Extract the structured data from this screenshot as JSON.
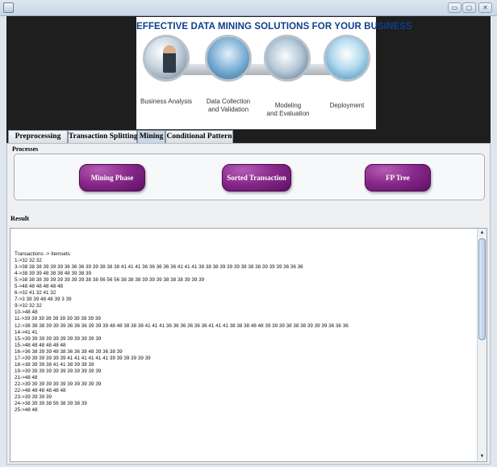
{
  "window": {
    "controls": {
      "minimize": "▭",
      "maximize": "▢",
      "close": "✕"
    }
  },
  "banner": {
    "title": "EFFECTIVE DATA MINING SOLUTIONS FOR YOUR BUSINESS",
    "stages": [
      {
        "label": "Business Analysis"
      },
      {
        "label": "Data Collection\nand Validation"
      },
      {
        "label": "Modeling\nand Evaluation"
      },
      {
        "label": "Deployment"
      }
    ]
  },
  "tabs": [
    {
      "label": "Preprocessing",
      "active": false
    },
    {
      "label": "Transaction Splitting",
      "active": false
    },
    {
      "label": "Mining",
      "active": true
    },
    {
      "label": "Conditional Pattern",
      "active": false
    }
  ],
  "processes": {
    "label": "Processes",
    "buttons": [
      {
        "label": "Mining Phase"
      },
      {
        "label": "Sorted Transaction"
      },
      {
        "label": "FP Tree"
      }
    ]
  },
  "result": {
    "label": "Result",
    "lines": [
      "Transactions -> Itemsets",
      "1->32 32 32",
      "3->38 38 38 39 39 39 36 36 36 39 39 38 38 38 41 41 41 36 36 36 36 36 41 41 41 38 38 38 39 39 39 38 38 38 39 39 39 36 36 36",
      "4->38 39 39 48 38 38 48 39 38 39",
      "5->38 38 38 39 39 39 39 39 39 38 38 56 56 56 38 38 38 39 39 39 38 38 38 39 39 39",
      "5->48 48 48 48 48 48",
      "6->32 41 32 41 32",
      "7->3 39 39 48 48 39 3 39",
      "9->32 32 32",
      "10->48 48",
      "11->39 39 39 39 39 39 39 39 39 39 39",
      "12->38 38 38 39 39 39 36 36 36 39 39 39 48 48 38 38 38 41 41 41 36 36 36 36 36 36 41 41 41 38 38 38 48 48 39 39 39 38 38 38 39 39 39 36 36 36",
      "14->41 41",
      "15->39 39 39 39 39 39 39 39 39 39 39",
      "15->48 48 48 48 48 48",
      "16->36 38 39 39 48 38 36 36 38 48 39 36 38 39",
      "17->39 39 39 39 39 39 41 41 41 41 41 41 39 39 39 39 39 39",
      "18->38 39 39 38 41 41 38 39 38 39",
      "19->39 39 39 39 39 39 39 39 39 39 39",
      "21->48 48",
      "22->39 39 39 39 39 39 39 39 39 39 39",
      "22->48 48 48 48 48 48",
      "23->39 39 39 39",
      "24->38 39 39 38 56 38 39 38 39",
      "25->48 48"
    ]
  }
}
